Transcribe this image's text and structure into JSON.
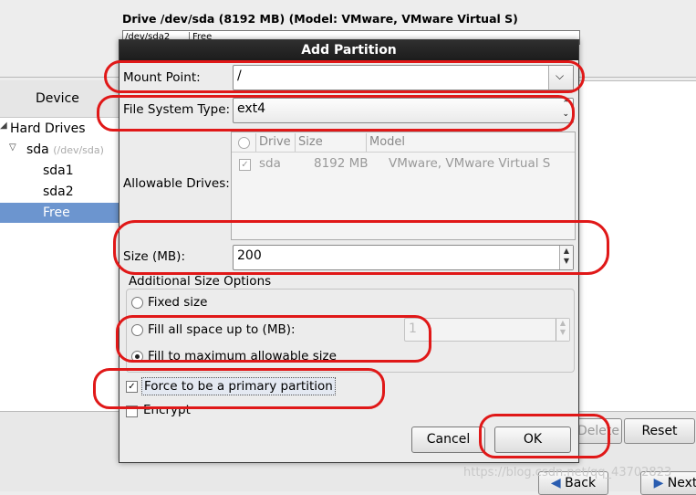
{
  "background": {
    "drive_title": "Drive /dev/sda (8192 MB) (Model: VMware, VMware Virtual S)",
    "drive_bar_segments": [
      "/dev/sda2",
      "Free"
    ],
    "device_header": "Device",
    "tree": {
      "hard_drives": "Hard Drives",
      "sda": "sda",
      "sda_path": "(/dev/sda)",
      "sda1": "sda1",
      "sda2": "sda2",
      "free": "Free"
    },
    "buttons": {
      "delete": "Delete",
      "reset": "Reset",
      "back": "Back",
      "next": "Next"
    },
    "watermark": "https://blog.csdn.net/qq_43702823"
  },
  "dialog": {
    "title": "Add Partition",
    "mount_point_label": "Mount Point:",
    "mount_point_value": "/",
    "fs_type_label": "File System Type:",
    "fs_type_value": "ext4",
    "drives_label": "Allowable Drives:",
    "drives_columns": [
      "Drive",
      "Size",
      "Model"
    ],
    "drives_rows": [
      {
        "checked": true,
        "drive": "sda",
        "size": "8192 MB",
        "model": "VMware, VMware Virtual S"
      }
    ],
    "size_label": "Size (MB):",
    "size_value": "200",
    "size_options_legend": "Additional Size Options",
    "opt_fixed": "Fixed size",
    "opt_fill_upto": "Fill all space up to (MB):",
    "fill_upto_value": "1",
    "opt_fill_max": "Fill to maximum allowable size",
    "selected_option": "Fill to maximum allowable size",
    "primary_label": "Force to be a primary partition",
    "primary_checked": true,
    "encrypt_label": "Encrypt",
    "encrypt_checked": false,
    "cancel_label": "Cancel",
    "ok_label": "OK"
  },
  "colors": {
    "annotation_red": "#e01818",
    "selection_blue": "#6c95cf",
    "titlebar": "#1c1c1c"
  }
}
